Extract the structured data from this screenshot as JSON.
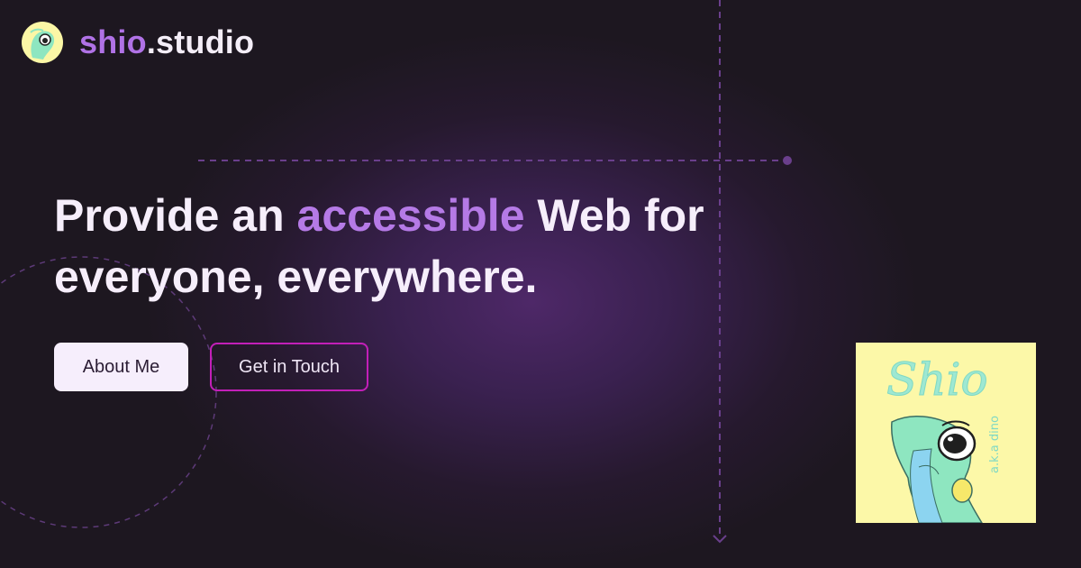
{
  "brand": {
    "accent": "shio",
    "rest": ".studio"
  },
  "hero": {
    "line1_before": "Provide an ",
    "line1_accent": "accessible",
    "line1_after": " Web for",
    "line2": "everyone, everywhere."
  },
  "buttons": {
    "primary": "About Me",
    "secondary": "Get in Touch"
  },
  "artwork": {
    "title": "Shio",
    "subtitle": "a.k.a dino"
  },
  "colors": {
    "background": "#1d1720",
    "glow": "#4e2868",
    "accent": "#b57ae6",
    "button_border": "#c21fb8",
    "artwork_bg": "#fcf8a8",
    "dino": "#8ee6c0"
  }
}
